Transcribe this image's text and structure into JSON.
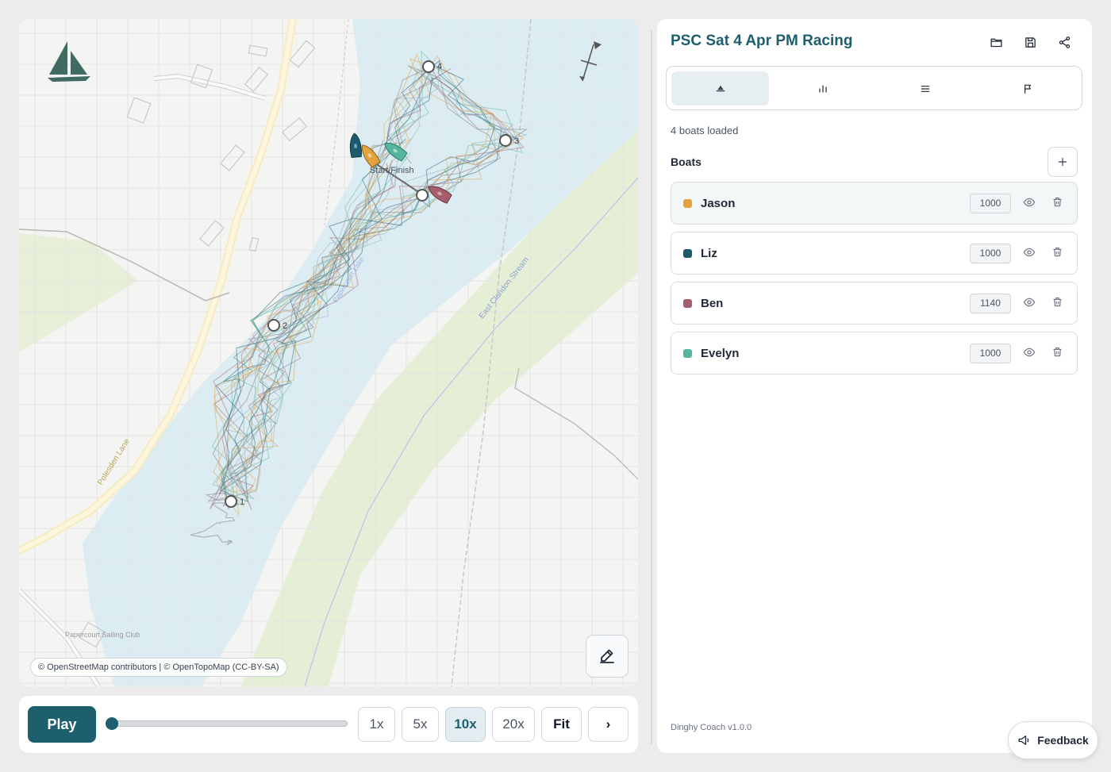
{
  "map": {
    "attribution": "© OpenStreetMap contributors | © OpenTopoMap (CC-BY-SA)",
    "labels": {
      "start_finish": "Start/Finish",
      "road": "Polesden Lane",
      "stream": "East Clandon Stream",
      "lake": "Papercourt Lake",
      "club": "Papercourt Sailing Club"
    },
    "marks": [
      {
        "label": "1"
      },
      {
        "label": "2"
      },
      {
        "label": "3"
      },
      {
        "label": "4"
      }
    ],
    "icons": {
      "logo": "sailboat-logo-icon",
      "north": "wind-direction-icon",
      "edit": "pen-icon"
    }
  },
  "playback": {
    "play_label": "Play",
    "progress": 0.0,
    "speeds": [
      "1x",
      "5x",
      "10x",
      "20x"
    ],
    "active_speed": "10x",
    "fit_label": "Fit",
    "next_label": "›"
  },
  "panel": {
    "title": "PSC Sat 4 Apr PM Racing",
    "header_icons": [
      "folder-icon",
      "save-icon",
      "share-icon"
    ],
    "tabs": [
      "sailboat-icon",
      "bar-chart-icon",
      "list-icon",
      "flag-icon"
    ],
    "active_tab": 0,
    "status": "4 boats loaded",
    "boats_heading": "Boats",
    "boats": [
      {
        "name": "Jason",
        "number": "1000",
        "color": "#e3a23b"
      },
      {
        "name": "Liz",
        "number": "1000",
        "color": "#1d5a6c"
      },
      {
        "name": "Ben",
        "number": "1140",
        "color": "#a45e6c"
      },
      {
        "name": "Evelyn",
        "number": "1000",
        "color": "#55b59e"
      }
    ],
    "version": "Dinghy Coach v1.0.0"
  },
  "feedback": {
    "label": "Feedback"
  },
  "colors": {
    "accent": "#1e5f6e",
    "water": "#dcedf3",
    "grass": "#e6f0d8"
  }
}
